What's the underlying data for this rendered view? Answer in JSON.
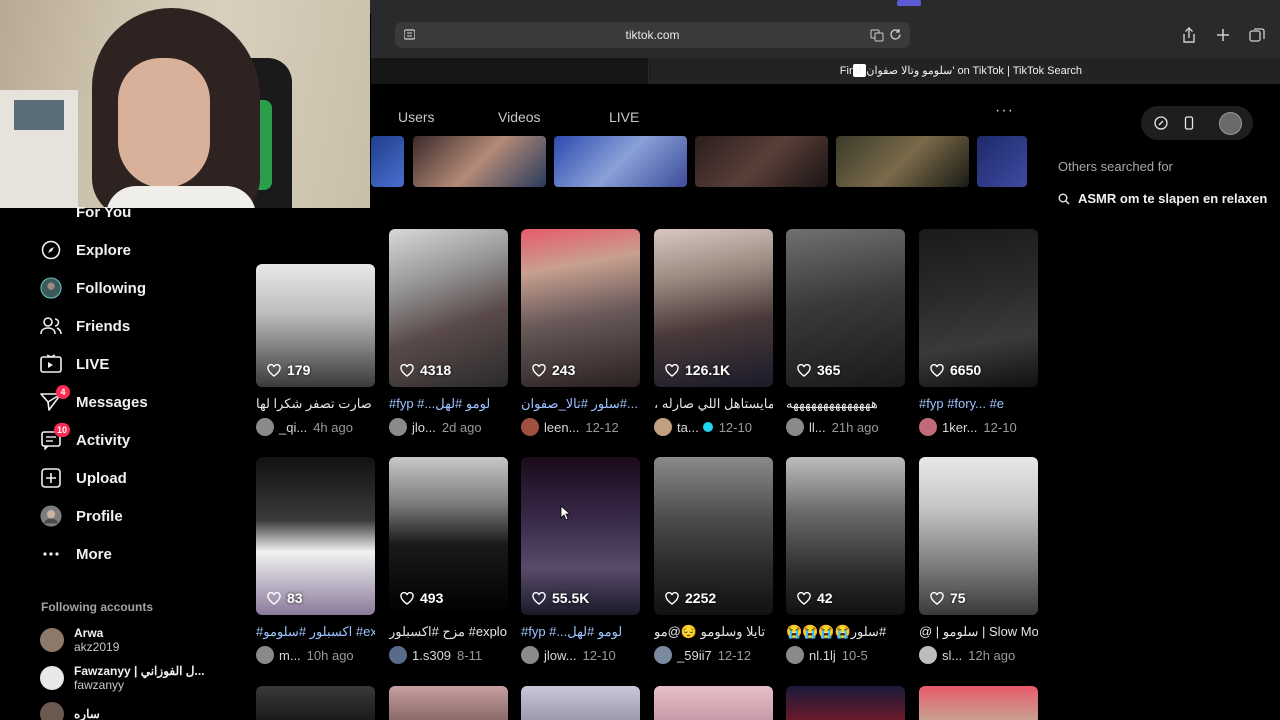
{
  "browser": {
    "url": "tiktok.com",
    "tab_title": "Find 'سلومو وتالا صفوان' on TikTok | TikTok Search"
  },
  "content_tabs": [
    "Users",
    "Videos",
    "LIVE"
  ],
  "more_label": "···",
  "sidebar": {
    "items": [
      {
        "label": "For You",
        "icon": "home-icon"
      },
      {
        "label": "Explore",
        "icon": "compass-icon"
      },
      {
        "label": "Following",
        "icon": "following-avatar-icon"
      },
      {
        "label": "Friends",
        "icon": "friends-icon"
      },
      {
        "label": "LIVE",
        "icon": "live-icon"
      },
      {
        "label": "Messages",
        "icon": "send-icon",
        "badge": "4"
      },
      {
        "label": "Activity",
        "icon": "activity-icon",
        "badge": "10"
      },
      {
        "label": "Upload",
        "icon": "plus-square-icon"
      },
      {
        "label": "Profile",
        "icon": "avatar-icon"
      },
      {
        "label": "More",
        "icon": "ellipsis-icon"
      }
    ],
    "following_title": "Following accounts",
    "accounts": [
      {
        "name": "Arwa",
        "handle": "akz2019"
      },
      {
        "name": "Fawzanyy | ل الفوزاني...",
        "handle": "fawzanyy"
      },
      {
        "name": "ساره",
        "handle": ""
      }
    ]
  },
  "others": {
    "title": "Others searched for",
    "item": "ASMR om te slapen en relaxen"
  },
  "videos_row1": [
    {
      "likes": "179",
      "caption": "صارت تصفر شكرا لها",
      "user": "_qi...",
      "time": "4h ago",
      "tag": false
    },
    {
      "likes": "4318",
      "caption": "#fyp #...لومو #لهل",
      "user": "jlo...",
      "time": "2d ago",
      "tag": true
    },
    {
      "likes": "243",
      "caption": "سلور #تالا_صفوان#...",
      "user": "leen...",
      "time": "12-12",
      "tag": true
    },
    {
      "likes": "126.1K",
      "caption": "، ومايستاهل اللي صارله",
      "user": "ta...",
      "time": "12-10",
      "tag": false,
      "verified": true
    },
    {
      "likes": "365",
      "caption": "ههههههههههههههه",
      "user": "ll...",
      "time": "21h ago",
      "tag": false
    },
    {
      "likes": "6650",
      "caption": "#fyp #fory... #e",
      "user": "1ker...",
      "time": "12-10",
      "tag": true
    }
  ],
  "videos_row2": [
    {
      "likes": "83",
      "caption": "#اكسبلور #سلومو #ex",
      "user": "m...",
      "time": "10h ago",
      "tag": true
    },
    {
      "likes": "493",
      "caption": "مزح #اكسبلور #explo",
      "user": "1.s309",
      "time": "8-11",
      "tag": false
    },
    {
      "likes": "55.5K",
      "caption": "#fyp #...لومو #لهل",
      "user": "jlow...",
      "time": "12-10",
      "tag": true
    },
    {
      "likes": "2252",
      "caption": "تايلا وسلومو 😔@مو",
      "user": "_59ii7",
      "time": "12-12",
      "tag": false
    },
    {
      "likes": "42",
      "caption": "😭😭😭😭سلور#",
      "user": "nl.1lj",
      "time": "10-5",
      "tag": false
    },
    {
      "likes": "75",
      "caption": "@ | سلومو | Slow Mo",
      "user": "sl...",
      "time": "12h ago",
      "tag": false
    }
  ],
  "colors": {
    "accent": "#fe2c55",
    "hashtag": "#9ec3ff",
    "verified": "#20d5ec"
  }
}
